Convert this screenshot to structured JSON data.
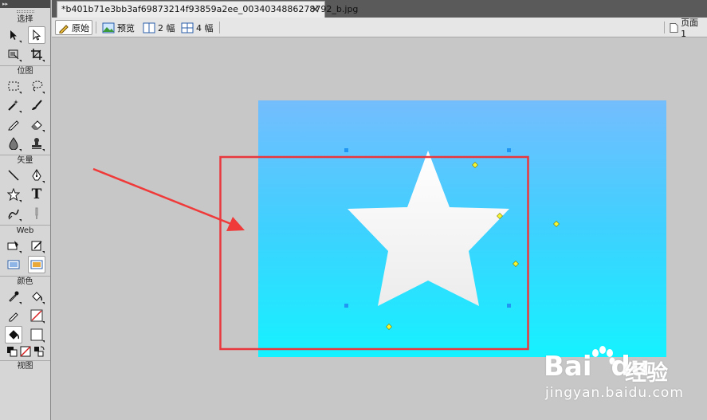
{
  "tools_panel": {
    "sections": {
      "select": "选择",
      "bitmap": "位图",
      "vector": "矢量",
      "web": "Web",
      "colors": "颜色",
      "view": "视图"
    },
    "text_tool_glyph": "T"
  },
  "document_tab": {
    "title": "*b401b71e3bb3af69873214f93859a2ee_0034034886278792_b.jpg"
  },
  "view_toolbar": {
    "original": "原始",
    "preview": "预览",
    "two_up": "2 幅",
    "four_up": "4 幅",
    "page": "页面 1"
  },
  "watermark": {
    "logo": "Bai",
    "logo_suffix": "du",
    "cn": "经验",
    "url": "jingyan.baidu.com"
  },
  "colors": {
    "canvas_top": "#74bdfd",
    "canvas_bottom": "#15f2ff",
    "highlight_box": "#e8383d",
    "arrow": "#f03a3a",
    "handle": "#2196f3",
    "point": "#f5f531"
  }
}
